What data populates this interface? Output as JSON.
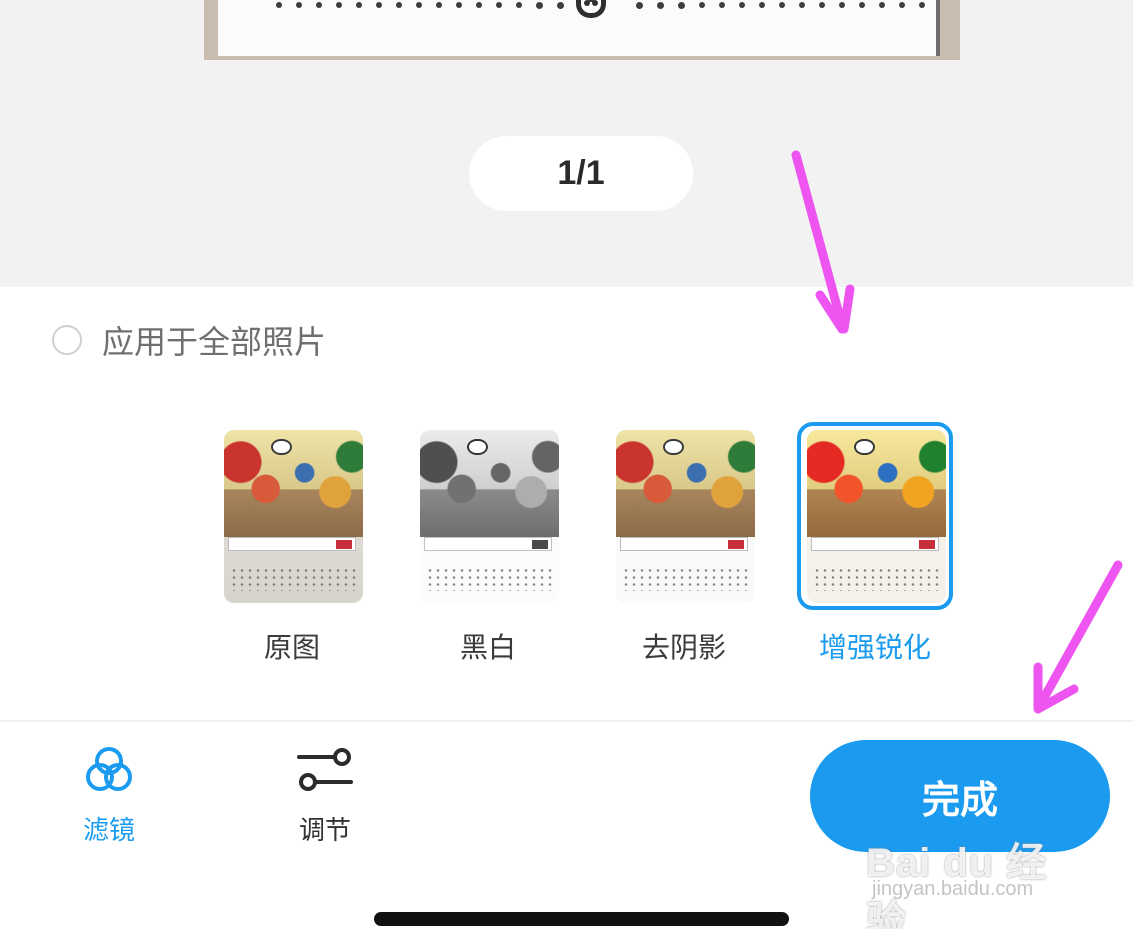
{
  "preview": {
    "page_indicator": "1/1"
  },
  "apply_all": {
    "label": "应用于全部照片",
    "checked": false
  },
  "filters": {
    "items": [
      {
        "label": "原图",
        "selected": false
      },
      {
        "label": "黑白",
        "selected": false
      },
      {
        "label": "去阴影",
        "selected": false
      },
      {
        "label": "增强锐化",
        "selected": true
      }
    ]
  },
  "toolbar": {
    "filter_label": "滤镜",
    "adjust_label": "调节",
    "done_label": "完成"
  },
  "watermark": {
    "main": "Bai du 经验",
    "sub": "jingyan.baidu.com"
  },
  "colors": {
    "accent": "#1a9bf0",
    "annotation_arrow": "#ee55f0",
    "preview_bg": "#f2f2f2"
  },
  "icons": {
    "filter": "three-circles-icon",
    "adjust": "sliders-icon",
    "document_emblem": "paw-icon"
  }
}
